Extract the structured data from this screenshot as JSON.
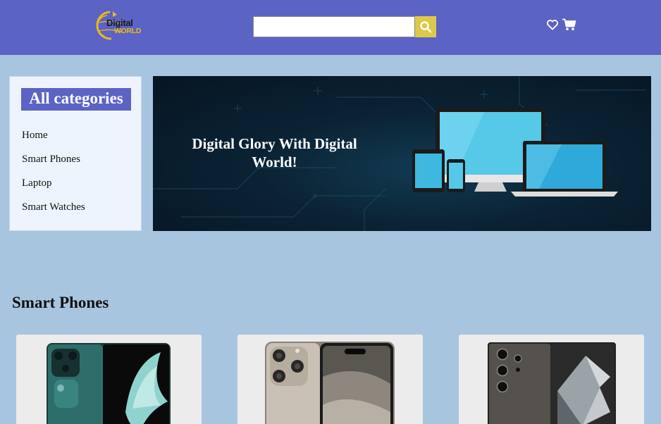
{
  "header": {
    "logo": {
      "line1": "Digital",
      "line2": "WORLD"
    },
    "search": {
      "value": "",
      "placeholder": ""
    },
    "icons": [
      "search-icon",
      "heart-icon",
      "cart-icon"
    ]
  },
  "sidebar": {
    "title": "All categories",
    "items": [
      {
        "label": "Home"
      },
      {
        "label": "Smart Phones"
      },
      {
        "label": "Laptop"
      },
      {
        "label": "Smart Watches"
      }
    ]
  },
  "banner": {
    "title": "Digital Glory With Digital World!"
  },
  "section": {
    "title": "Smart Phones",
    "products": [
      {
        "image": "green-foldable-phone"
      },
      {
        "image": "titanium-iphone"
      },
      {
        "image": "titanium-galaxy-phone"
      }
    ]
  },
  "colors": {
    "header_bg": "#5b63c4",
    "page_bg": "#a8c5e0",
    "accent_yellow": "#dcc94a",
    "sidebar_bg": "#eef4fd",
    "card_bg": "#ececec"
  }
}
